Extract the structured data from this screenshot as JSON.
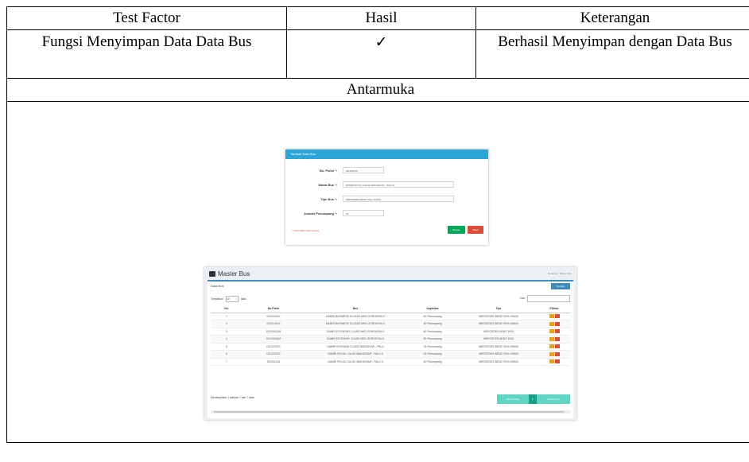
{
  "table": {
    "headers": [
      "Test Factor",
      "Hasil",
      "Keterangan"
    ],
    "row": {
      "test_factor": "Fungsi Menyimpan Data Data Bus",
      "hasil": "✓",
      "keterangan": "Berhasil Menyimpan dengan Data Bus"
    },
    "section_label": "Antarmuka"
  },
  "form_screenshot": {
    "title": "Tambah Data Bus",
    "fields": [
      {
        "label": "No. Polisi *:",
        "value": "DD4312JA"
      },
      {
        "label": "Nama Bus *:",
        "value": "DAMRI ROYAL CALSS MAKASSAR - PALU 3"
      },
      {
        "label": "Tipe Bus *:",
        "value": "MERCEDES-BENZ SOH-OH640"
      },
      {
        "label": "Jumlah Penumpang *:",
        "value": "30"
      }
    ],
    "note": "* Field tidak boleh kosong",
    "save_label": "Simpan",
    "cancel_label": "Batal",
    "colors": {
      "header": "#2aa7d8",
      "save": "#00a65a",
      "cancel": "#dd4b39"
    }
  },
  "list_screenshot": {
    "title": "Master Bus",
    "breadcrumb": "Beranda > Master Bus",
    "box_title": "Data Bus",
    "add_label": "Tambah",
    "show_prefix": "Tampilkan",
    "show_value": "10",
    "show_suffix": "data",
    "search_label": "Cari:",
    "columns": [
      "No.",
      "No.Polisi",
      "Bus",
      "Kapisitas",
      "Tipe",
      "Pilihan"
    ],
    "rows": [
      [
        "1",
        "DD1243XX",
        "DAMRI BUSINESS CLASSS MKS-GORONTALO",
        "40 Penumpang",
        "MERCEDES-BENZ SOH-OH640"
      ],
      [
        "2",
        "DD1213XX",
        "DAMRI BUSINESS CLASSS MKS-GORONTALO",
        "40 Penumpang",
        "MERCEDES-BENZ SOH-OH640"
      ],
      [
        "3",
        "DD1941QM",
        "DAMRI ECONOMY CLASS MKS-GORONTALO",
        "40 Penumpang",
        "MERCEDES-BENZ 1526"
      ],
      [
        "4",
        "DD1940QM",
        "DAMRI ECONOMY CLASS MKS-GORONTALO",
        "40 Penumpang",
        "MERCEDES-BENZ 1526"
      ],
      [
        "5",
        "DD1223CS",
        "DAMRI EKONOMI CLASS MAKASSAR - PALU",
        "23 Penumpang",
        "MERCEDES-BENZ SOH-OH640"
      ],
      [
        "6",
        "DD1223CS",
        "DAMRI ROYAL CALSS MAKASSAR - PALU 3",
        "23 Penumpang",
        "MERCEDES-BENZ SOH-OH640"
      ],
      [
        "7",
        "DD4312JA",
        "DAMRI ROYAL CALSS MAKASSAR - PALU 3",
        "40 Penumpang",
        "MERCEDES-BENZ SOH-OH640"
      ]
    ],
    "info": "Menampilkan 1 sampai 7 dari 7 data",
    "prev_label": "Sebelumnya",
    "current_page": "1",
    "next_label": "Selanjutnya",
    "colors": {
      "accent": "#3c8dbc",
      "pager": "#5fd6c5",
      "pager_active": "#16a085"
    }
  }
}
